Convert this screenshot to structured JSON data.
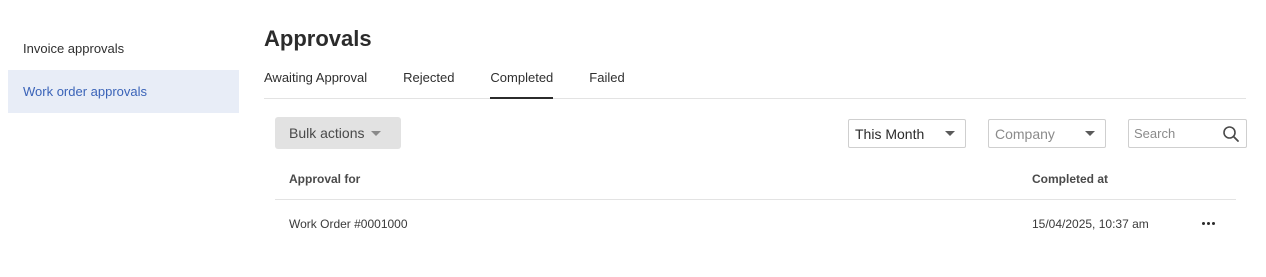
{
  "sidebar": {
    "items": [
      {
        "label": "Invoice approvals",
        "active": false
      },
      {
        "label": "Work order approvals",
        "active": true
      }
    ]
  },
  "page": {
    "title": "Approvals"
  },
  "tabs": [
    {
      "label": "Awaiting Approval",
      "active": false
    },
    {
      "label": "Rejected",
      "active": false
    },
    {
      "label": "Completed",
      "active": true
    },
    {
      "label": "Failed",
      "active": false
    }
  ],
  "toolbar": {
    "bulk_actions_label": "Bulk actions",
    "period_value": "This Month",
    "company_placeholder": "Company",
    "search_placeholder": "Search"
  },
  "table": {
    "columns": [
      "Approval for",
      "Completed at"
    ],
    "rows": [
      {
        "approval_for": "Work Order #0001000",
        "completed_at": "15/04/2025, 10:37 am"
      }
    ]
  },
  "icons": {
    "search": "search-icon",
    "caret": "chevron-down-icon",
    "more": "more-horizontal-icon"
  },
  "colors": {
    "active_sidebar_bg": "#e8edf7",
    "active_sidebar_text": "#3a63b8",
    "bulk_button_bg": "#e2e2e2"
  }
}
